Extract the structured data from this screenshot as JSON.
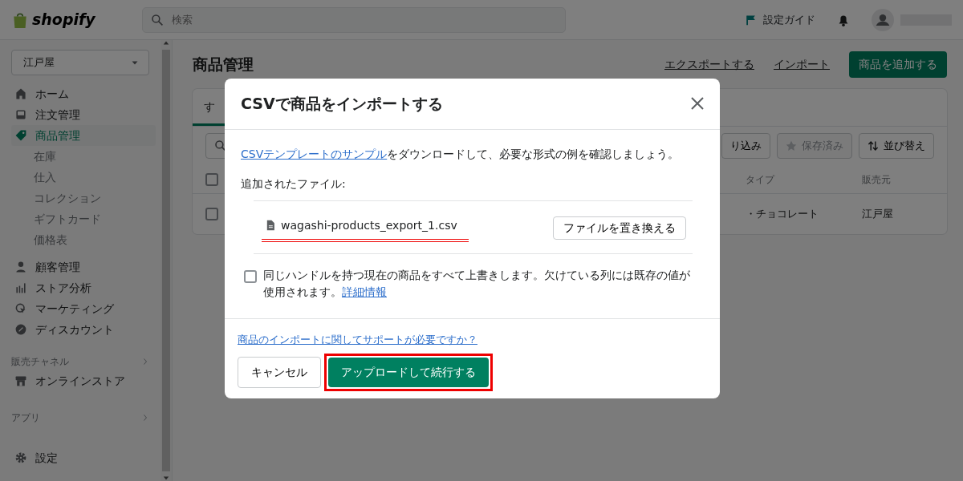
{
  "topbar": {
    "logo": "shopify",
    "search": {
      "placeholder": "検索"
    },
    "setup_guide": "設定ガイド"
  },
  "sidebar": {
    "store": "江戸屋",
    "items": [
      {
        "label": "ホーム",
        "kind": "home",
        "selected": false
      },
      {
        "label": "注文管理",
        "kind": "inbox",
        "selected": false
      },
      {
        "label": "商品管理",
        "kind": "tag",
        "selected": true,
        "children": [
          {
            "label": "在庫"
          },
          {
            "label": "仕入"
          },
          {
            "label": "コレクション"
          },
          {
            "label": "ギフトカード"
          },
          {
            "label": "価格表"
          }
        ]
      },
      {
        "label": "顧客管理",
        "kind": "person",
        "selected": false
      },
      {
        "label": "ストア分析",
        "kind": "chart",
        "selected": false
      },
      {
        "label": "マーケティング",
        "kind": "target",
        "selected": false
      },
      {
        "label": "ディスカウント",
        "kind": "discount",
        "selected": false
      }
    ],
    "sections": [
      {
        "title": "販売チャネル",
        "items": [
          {
            "label": "オンラインストア",
            "kind": "store"
          }
        ]
      },
      {
        "title": "アプリ"
      }
    ],
    "settings": "設定"
  },
  "page": {
    "title": "商品管理",
    "actions": [
      "エクスポートする",
      "インポート"
    ],
    "primary": "商品を追加する",
    "tabs": [
      {
        "label": "す",
        "selected": true
      }
    ],
    "filters": [
      {
        "label": "り込み",
        "kind": "plain",
        "disabled": false
      },
      {
        "label": "保存済み",
        "kind": "star",
        "disabled": true
      },
      {
        "label": "並び替え",
        "kind": "sort",
        "disabled": false
      }
    ],
    "header_checked": false,
    "columns": [
      "タイプ",
      "販売元"
    ],
    "rows": [
      {
        "checked": false,
        "cells": [
          "・チョコレート",
          "江戸屋"
        ]
      }
    ]
  },
  "modal": {
    "title": "CSVで商品をインポートする",
    "intro_link": "CSVテンプレートのサンプル",
    "intro_text": "をダウンロードして、必要な形式の例を確認しましょう。",
    "files_label": "追加されたファイル:",
    "file": {
      "name": "wagashi-products_export_1.csv",
      "underlined": true
    },
    "replace_button": "ファイルを置き換える",
    "overwrite": {
      "checked": false,
      "text": "同じハンドルを持つ現在の商品をすべて上書きします。欠けている列には既存の値が使用されます。",
      "link": "詳細情報"
    },
    "help_link": "商品のインポートに関してサポートが必要ですか？",
    "cancel": "キャンセル",
    "submit": {
      "label": "アップロードして続行する",
      "highlighted": true
    }
  }
}
